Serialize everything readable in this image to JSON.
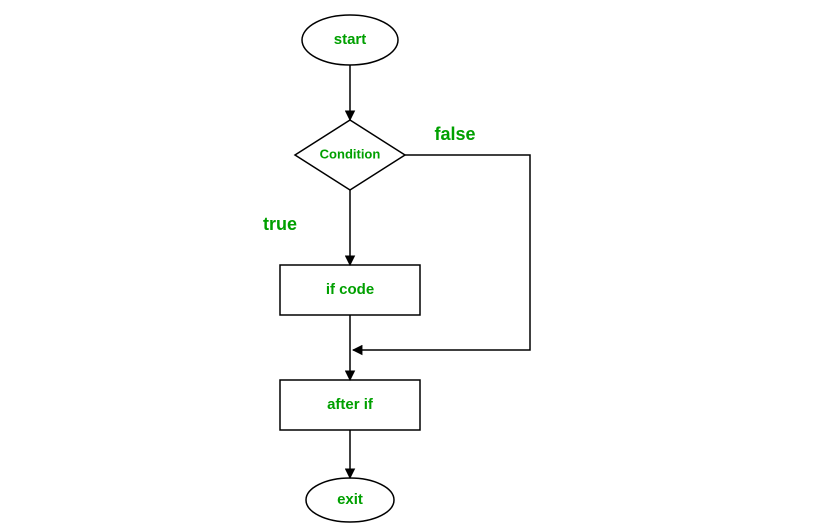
{
  "diagram": {
    "type": "flowchart",
    "nodes": {
      "start": {
        "label": "start",
        "shape": "ellipse"
      },
      "condition": {
        "label": "Condition",
        "shape": "diamond"
      },
      "if_code": {
        "label": "if code",
        "shape": "rect"
      },
      "after_if": {
        "label": "after if",
        "shape": "rect"
      },
      "exit": {
        "label": "exit",
        "shape": "ellipse"
      }
    },
    "edge_labels": {
      "true": "true",
      "false": "false"
    },
    "edges": [
      {
        "from": "start",
        "to": "condition"
      },
      {
        "from": "condition",
        "to": "if_code",
        "label_key": "true"
      },
      {
        "from": "condition",
        "to": "after_if",
        "label_key": "false"
      },
      {
        "from": "if_code",
        "to": "after_if"
      },
      {
        "from": "after_if",
        "to": "exit"
      }
    ],
    "colors": {
      "text": "#00a000",
      "stroke": "#000000",
      "fill": "#ffffff"
    }
  }
}
